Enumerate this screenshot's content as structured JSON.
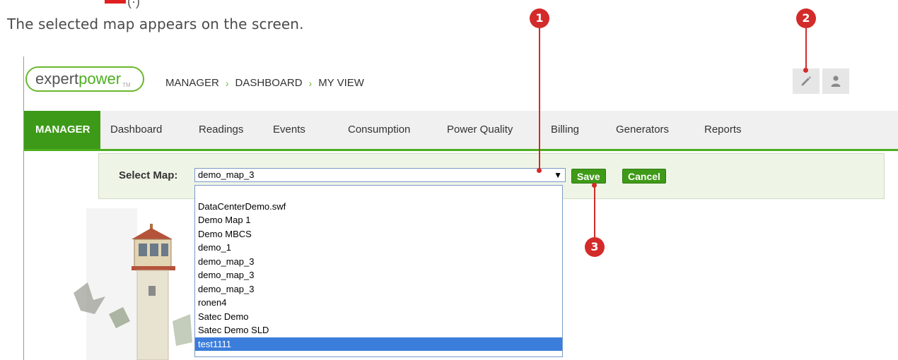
{
  "doc": {
    "caption": "The selected map appears on the screen.",
    "partial_top_text": "(·)"
  },
  "header": {
    "logo": {
      "word1": "expert",
      "word2": "power",
      "tm": "TM"
    },
    "breadcrumb": [
      "MANAGER",
      "DASHBOARD",
      "MY VIEW"
    ],
    "edit_icon": "pencil-icon",
    "user_icon": "user-icon"
  },
  "nav": {
    "items": [
      "MANAGER",
      "Dashboard",
      "Readings",
      "Events",
      "Consumption",
      "Power Quality",
      "Billing",
      "Generators",
      "Reports"
    ],
    "active": "MANAGER"
  },
  "map_bar": {
    "label": "Select Map:",
    "selected_value": "demo_map_3",
    "save_label": "Save",
    "cancel_label": "Cancel",
    "options": [
      "",
      "DataCenterDemo.swf",
      "Demo Map 1",
      "Demo MBCS",
      "demo_1",
      "demo_map_3",
      "demo_map_3",
      "demo_map_3",
      "ronen4",
      "Satec Demo",
      "Satec Demo SLD",
      "test1111"
    ],
    "highlighted_option": "test1111"
  },
  "callouts": {
    "c1": "1",
    "c2": "2",
    "c3": "3"
  },
  "colors": {
    "accent_green": "#3d9a18",
    "callout_red": "#d32a2a",
    "highlight_blue": "#3b7ddb"
  }
}
